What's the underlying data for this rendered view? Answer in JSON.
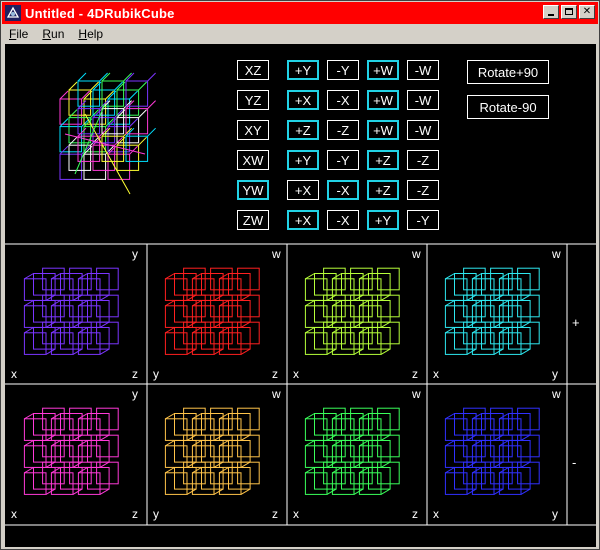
{
  "window": {
    "title": "Untitled - 4DRubikCube"
  },
  "menu": [
    {
      "label": "File",
      "u": "F",
      "rest": "ile"
    },
    {
      "label": "Run",
      "u": "R",
      "rest": "un"
    },
    {
      "label": "Help",
      "u": "H",
      "rest": "elp"
    }
  ],
  "controls": {
    "rows": [
      {
        "plane": "XZ",
        "plane_active": false,
        "ops": [
          [
            "+Y",
            true
          ],
          [
            "-Y",
            false
          ],
          [
            "+W",
            true
          ],
          [
            "-W",
            false
          ]
        ]
      },
      {
        "plane": "YZ",
        "plane_active": false,
        "ops": [
          [
            "+X",
            true
          ],
          [
            "-X",
            false
          ],
          [
            "+W",
            true
          ],
          [
            "-W",
            false
          ]
        ]
      },
      {
        "plane": "XY",
        "plane_active": false,
        "ops": [
          [
            "+Z",
            true
          ],
          [
            "-Z",
            false
          ],
          [
            "+W",
            true
          ],
          [
            "-W",
            false
          ]
        ]
      },
      {
        "plane": "XW",
        "plane_active": false,
        "ops": [
          [
            "+Y",
            true
          ],
          [
            "-Y",
            false
          ],
          [
            "+Z",
            true
          ],
          [
            "-Z",
            false
          ]
        ]
      },
      {
        "plane": "YW",
        "plane_active": true,
        "ops": [
          [
            "+X",
            false
          ],
          [
            "-X",
            true
          ],
          [
            "+Z",
            true
          ],
          [
            "-Z",
            false
          ]
        ]
      },
      {
        "plane": "ZW",
        "plane_active": false,
        "ops": [
          [
            "+X",
            true
          ],
          [
            "-X",
            false
          ],
          [
            "+Y",
            true
          ],
          [
            "-Y",
            false
          ]
        ]
      }
    ],
    "rotate_pos": "Rotate+90",
    "rotate_neg": "Rotate-90"
  },
  "views": [
    {
      "row": 0,
      "col": 0,
      "color": "#7b35ff",
      "top": "y",
      "bl": "x",
      "br": "z"
    },
    {
      "row": 0,
      "col": 1,
      "color": "#ff2020",
      "top": "w",
      "bl": "y",
      "br": "z"
    },
    {
      "row": 0,
      "col": 2,
      "color": "#b6ff3a",
      "top": "w",
      "bl": "x",
      "br": "z"
    },
    {
      "row": 0,
      "col": 3,
      "color": "#2ee8f0",
      "top": "w",
      "bl": "x",
      "br": "y"
    },
    {
      "row": 1,
      "col": 0,
      "color": "#ff3ad8",
      "top": "y",
      "bl": "x",
      "br": "z"
    },
    {
      "row": 1,
      "col": 1,
      "color": "#ffc44a",
      "top": "w",
      "bl": "y",
      "br": "z"
    },
    {
      "row": 1,
      "col": 2,
      "color": "#3aff5a",
      "top": "w",
      "bl": "x",
      "br": "z"
    },
    {
      "row": 1,
      "col": 3,
      "color": "#3030ff",
      "top": "w",
      "bl": "x",
      "br": "y"
    }
  ],
  "row_signs": [
    "+",
    "-"
  ],
  "main_cube_colors": [
    "#ff3ad8",
    "#ffff33",
    "#00e0ff",
    "#3aff5a",
    "#7b35ff",
    "#ffffff"
  ]
}
